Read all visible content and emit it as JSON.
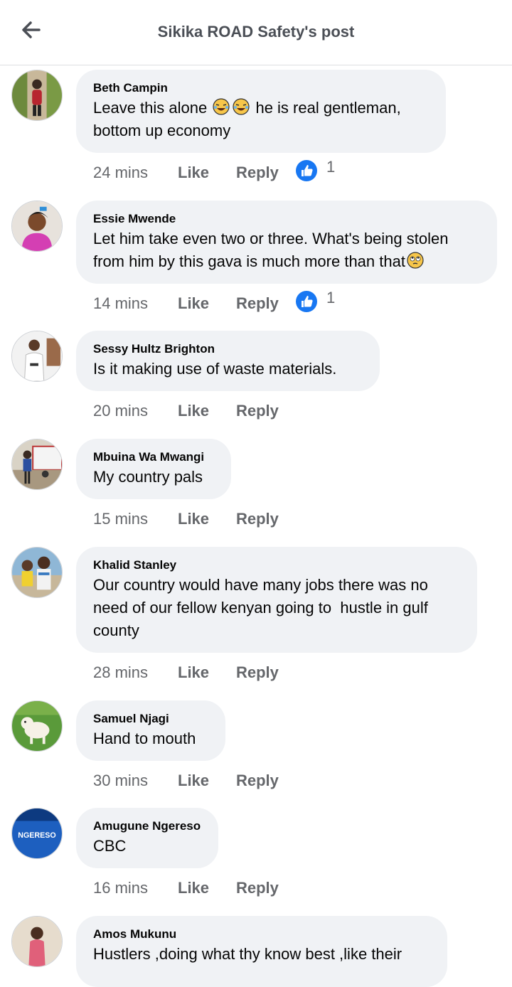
{
  "header": {
    "title": "Sikika ROAD Safety's post",
    "back_icon": "arrow-left-icon"
  },
  "colors": {
    "bubble": "#f0f2f5",
    "like_blue": "#1877f2",
    "meta_grey": "#65676b"
  },
  "comments": [
    {
      "author": "Beth Campin",
      "text_before": "Leave this alone ",
      "emoji": "rofl-emoji-icon x2",
      "text_after": " he is real gentleman, bottom up economy",
      "time": "24 mins",
      "like": "Like",
      "reply": "Reply",
      "reactions": "1"
    },
    {
      "author": "Essie Mwende",
      "text": "Let him take even two or three. What's being stolen from him by this gava is much more than that",
      "emoji": "eye-roll-emoji-icon",
      "time": "14 mins",
      "like": "Like",
      "reply": "Reply",
      "reactions": "1"
    },
    {
      "author": "Sessy Hultz Brighton",
      "text": "Is it making use of waste materials.",
      "time": "20 mins",
      "like": "Like",
      "reply": "Reply"
    },
    {
      "author": "Mbuina Wa Mwangi",
      "text": "My country pals",
      "time": "15 mins",
      "like": "Like",
      "reply": "Reply"
    },
    {
      "author": "Khalid Stanley",
      "text": "Our country would have many jobs there was no need of our fellow kenyan going to  hustle in gulf county",
      "time": "28 mins",
      "like": "Like",
      "reply": "Reply"
    },
    {
      "author": "Samuel Njagi",
      "text": "Hand to mouth",
      "time": "30 mins",
      "like": "Like",
      "reply": "Reply"
    },
    {
      "author": "Amugune Ngereso",
      "text": "CBC",
      "avatar_text": "NGERESO",
      "time": "16 mins",
      "like": "Like",
      "reply": "Reply"
    },
    {
      "author": "Amos Mukunu",
      "text": "Hustlers ,doing what thy know best ,like their"
    }
  ]
}
